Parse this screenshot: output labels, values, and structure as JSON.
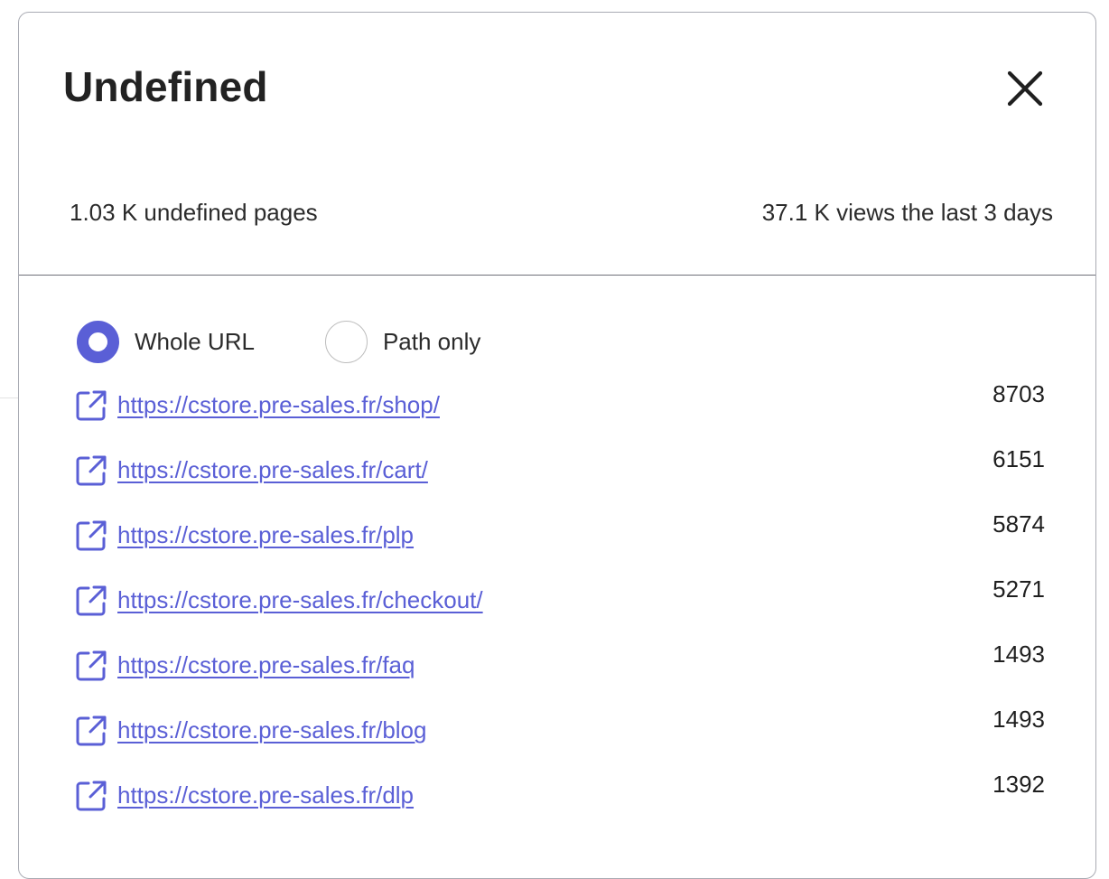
{
  "modal": {
    "title": "Undefined",
    "close_icon": "close-icon",
    "stats": {
      "pages": "1.03 K undefined pages",
      "views": "37.1 K views the last 3 days"
    },
    "view_mode": {
      "options": [
        {
          "label": "Whole URL",
          "checked": true
        },
        {
          "label": "Path only",
          "checked": false
        }
      ]
    },
    "urls": [
      {
        "url": "https://cstore.pre-sales.fr/shop/",
        "views": "8703"
      },
      {
        "url": "https://cstore.pre-sales.fr/cart/",
        "views": "6151"
      },
      {
        "url": "https://cstore.pre-sales.fr/plp",
        "views": "5874"
      },
      {
        "url": "https://cstore.pre-sales.fr/checkout/",
        "views": "5271"
      },
      {
        "url": "https://cstore.pre-sales.fr/faq",
        "views": "1493"
      },
      {
        "url": "https://cstore.pre-sales.fr/blog",
        "views": "1493"
      },
      {
        "url": "https://cstore.pre-sales.fr/dlp",
        "views": "1392"
      }
    ],
    "link_icon": "external-link-icon"
  },
  "colors": {
    "accent": "#5a5fd6",
    "border": "#a9abb3",
    "divider": "#6e7079",
    "text": "#1f1f1f"
  }
}
